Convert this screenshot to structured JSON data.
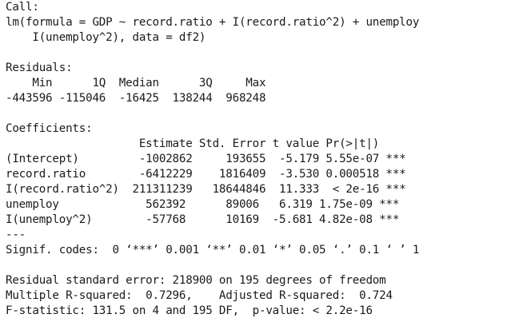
{
  "call": {
    "label": "Call:",
    "line1": "lm(formula = GDP ~ record.ratio + I(record.ratio^2) + unemploy",
    "line2": "    I(unemploy^2), data = df2)"
  },
  "residuals": {
    "label": "Residuals:",
    "header": "    Min      1Q  Median      3Q     Max",
    "values": "-443596 -115046  -16425  138244  968248"
  },
  "coefficients": {
    "label": "Coefficients:",
    "header": "                    Estimate Std. Error t value Pr(>|t|)    ",
    "rows": [
      "(Intercept)         -1002862     193655  -5.179 5.55e-07 ***",
      "record.ratio        -6412229    1816409  -3.530 0.000518 ***",
      "I(record.ratio^2)  211311239   18644846  11.333  < 2e-16 ***",
      "unemploy             562392      89006   6.319 1.75e-09 ***",
      "I(unemploy^2)        -57768      10169  -5.681 4.82e-08 ***"
    ],
    "separator": "---",
    "signif": "Signif. codes:  0 ‘***’ 0.001 ‘**’ 0.01 ‘*’ 0.05 ‘.’ 0.1 ‘ ’ 1"
  },
  "summary": {
    "line1": "Residual standard error: 218900 on 195 degrees of freedom",
    "line2": "Multiple R-squared:  0.7296,    Adjusted R-squared:  0.724",
    "line3": "F-statistic: 131.5 on 4 and 195 DF,  p-value: < 2.2e-16"
  }
}
